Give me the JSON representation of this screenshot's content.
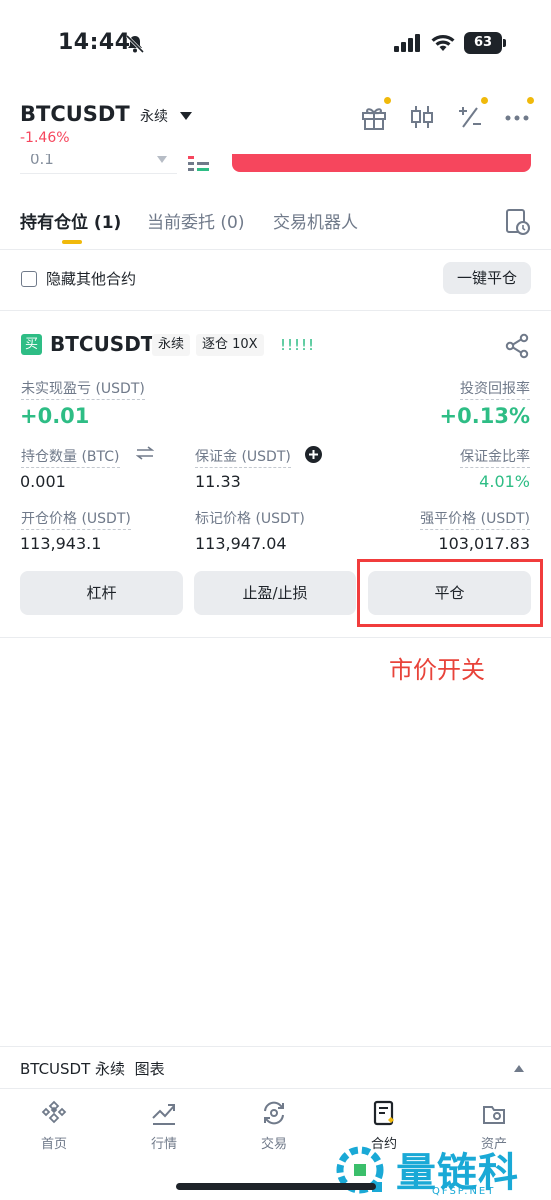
{
  "status_bar": {
    "time": "14:44",
    "battery": "63"
  },
  "header": {
    "symbol": "BTCUSDT",
    "type_tag": "永续",
    "change": "-1.46%"
  },
  "order_form": {
    "quantity": "0.1"
  },
  "tabs": [
    {
      "label": "持有仓位 (1)"
    },
    {
      "label": "当前委托 (0)"
    },
    {
      "label": "交易机器人"
    }
  ],
  "filter": {
    "hide_other_label": "隐藏其他合约",
    "close_all_label": "一键平仓"
  },
  "position": {
    "side_badge": "买",
    "symbol": "BTCUSDT",
    "type_tag": "永续",
    "margin_tag": "逐仓 10X",
    "unrealized_pnl_label": "未实现盈亏 (USDT)",
    "unrealized_pnl": "+0.01",
    "roi_label": "投资回报率",
    "roi": "+0.13%",
    "size_label": "持仓数量 (BTC)",
    "size": "0.001",
    "margin_label": "保证金 (USDT)",
    "margin": "11.33",
    "margin_ratio_label": "保证金比率",
    "margin_ratio": "4.01%",
    "entry_price_label": "开仓价格 (USDT)",
    "entry_price": "113,943.1",
    "mark_price_label": "标记价格 (USDT)",
    "mark_price": "113,947.04",
    "liq_price_label": "强平价格 (USDT)",
    "liq_price": "103,017.83",
    "actions": {
      "leverage": "杠杆",
      "tpsl": "止盈/止损",
      "close": "平仓"
    }
  },
  "annotation": "市价开关",
  "chart_bar": {
    "label": "BTCUSDT 永续  图表"
  },
  "bottom_nav": [
    {
      "label": "首页",
      "icon": "home-icon"
    },
    {
      "label": "行情",
      "icon": "markets-icon"
    },
    {
      "label": "交易",
      "icon": "trade-icon"
    },
    {
      "label": "合约",
      "icon": "futures-icon"
    },
    {
      "label": "资产",
      "icon": "wallet-icon"
    }
  ],
  "watermark": {
    "text": "量链科技",
    "sub": "QFSP.NET"
  },
  "colors": {
    "green": "#2ebd85",
    "red": "#f6465d",
    "yellow": "#f0b90b",
    "highlight": "#f13c3c"
  }
}
